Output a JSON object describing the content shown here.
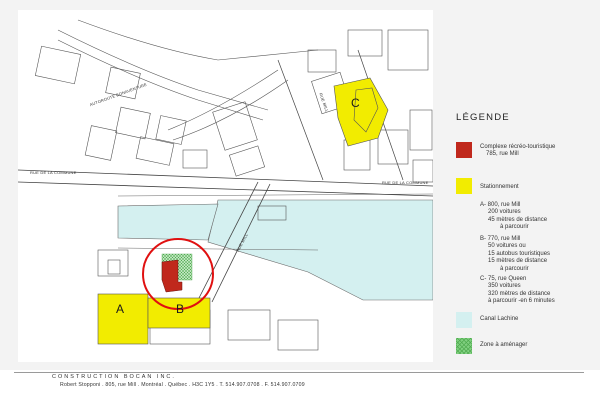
{
  "map": {
    "zone_labels": {
      "a": "A",
      "b": "B",
      "c": "C"
    },
    "street_labels": {
      "rue_de_la_commune_west": "RUE DE LA COMMUNE",
      "rue_de_la_commune_east": "RUE DE LA COMMUNE",
      "autoroute_bonaventure": "AUTOROUTE BONAVENTURE",
      "rue_mill_top": "RUE MILL",
      "rue_mill_bottom": "RUE MILL"
    }
  },
  "legend": {
    "title": "LÉGENDE",
    "items": [
      {
        "color": "#c0281c",
        "lines": [
          "Complexe récréo-touristique",
          "785, rue Mill"
        ]
      },
      {
        "color": "#f2ec00",
        "lines": [
          "Stationnement"
        ]
      },
      {
        "lines": [
          "A- 800, rue Mill",
          "200 voitures",
          "45 mètres de distance",
          "à parcourir"
        ]
      },
      {
        "lines": [
          "B- 770, rue Mill",
          "50 voitures ou",
          "15 autobus touristiques",
          "15 mètres de distance",
          "à parcourir"
        ]
      },
      {
        "lines": [
          "C- 75, rue Queen",
          "350 voitures",
          "320 mètres de distance",
          "à parcourir -en 6 minutes"
        ]
      },
      {
        "color": "#d4f0f0",
        "lines": [
          "Canal Lachine"
        ]
      },
      {
        "color": "#7fcf7f",
        "lines": [
          "Zone à aménager"
        ]
      }
    ]
  },
  "footer": {
    "company": "CONSTRUCTION BOCAN INC.",
    "address": "Robert Stopponi . 805, rue Mill . Montréal . Québec . H3C 1Y5 . T. 514.907.0708 . F. 514.907.0709"
  }
}
